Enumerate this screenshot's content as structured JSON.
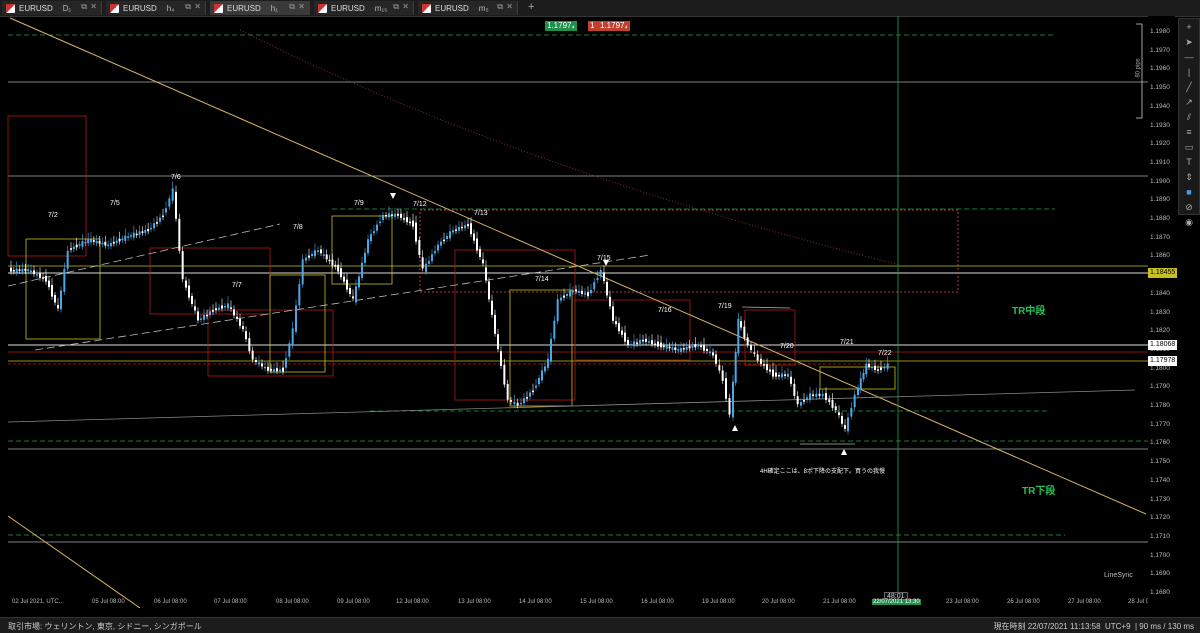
{
  "tabs": [
    {
      "symbol": "EURUSD",
      "timeframe": "D₁"
    },
    {
      "symbol": "EURUSD",
      "timeframe": "h₄"
    },
    {
      "symbol": "EURUSD",
      "timeframe": "h₁"
    },
    {
      "symbol": "EURUSD",
      "timeframe": "m₁₅"
    },
    {
      "symbol": "EURUSD",
      "timeframe": "m₅"
    }
  ],
  "trade": {
    "sell_price": "1.1797₄",
    "buy_price": "1.1797₄",
    "buy_qty": "1"
  },
  "price_ticks": [
    "1.1980",
    "1.1970",
    "1.1960",
    "1.1950",
    "1.1940",
    "1.1930",
    "1.1920",
    "1.1910",
    "1.1900",
    "1.1890",
    "1.1880",
    "1.1870",
    "1.1860",
    "1.1850",
    "1.1840",
    "1.1830",
    "1.1820",
    "1.1810",
    "1.1800",
    "1.1790",
    "1.1780",
    "1.1770",
    "1.1760",
    "1.1750",
    "1.1740",
    "1.1730",
    "1.1720",
    "1.1710",
    "1.1700",
    "1.1690",
    "1.1680"
  ],
  "price_tags": {
    "current": "1.18455",
    "level_b": "1.18068",
    "level_c": "1.17978"
  },
  "time_ticks": [
    "02 Jul 2021, UTC...",
    "05 Jul 08:00",
    "06 Jul 08:00",
    "07 Jul 08:00",
    "08 Jul 08:00",
    "09 Jul 08:00",
    "12 Jul 08:00",
    "13 Jul 08:00",
    "14 Jul 08:00",
    "15 Jul 08:00",
    "16 Jul 08:00",
    "19 Jul 08:00",
    "20 Jul 08:00",
    "21 Jul 08:00",
    "22/07/2021 13:30",
    "23 Jul 08:00",
    "26 Jul 08:00",
    "27 Jul 08:00",
    "28 Jul 08:00"
  ],
  "date_labels": [
    "7/2",
    "7/5",
    "7/6",
    "7/7",
    "7/8",
    "7/9",
    "7/12",
    "7/13",
    "7/14",
    "7/15",
    "7/16",
    "7/19",
    "7/20",
    "7/21",
    "7/22"
  ],
  "annotations": {
    "tr_mid": "TR中段",
    "tr_low": "TR下段",
    "note": "4H確定ここは、8ポ下降の支配下。買うの我慢",
    "pips": "80 pips",
    "countdown": "48:01",
    "watermark": "LineSync"
  },
  "status": {
    "markets": "取引市場: ウェリントン, 東京, シドニー, シンガポール",
    "time": "現在時刻 22/07/2021 11:13:58",
    "tz": "UTC+9",
    "latency": "| 90 ms / 130 ms"
  },
  "colors": {
    "bull": "#4aa8e8",
    "bear": "#ffffff",
    "trend": "#d9b46a",
    "level": "#ffffff",
    "box_red": "#b01818",
    "box_yellow": "#c8c020",
    "green_dash": "#2a9a4a"
  }
}
